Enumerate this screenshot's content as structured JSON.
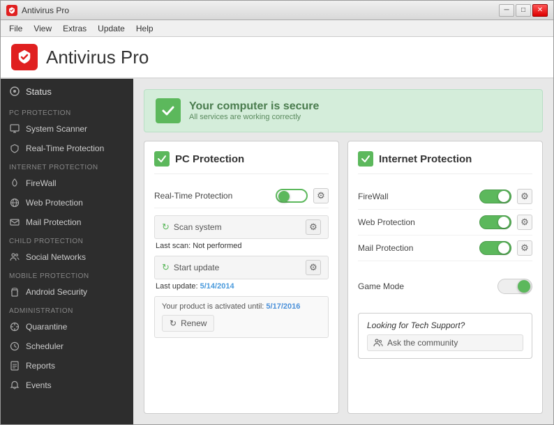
{
  "window": {
    "title": "Antivirus Pro",
    "minimize_label": "─",
    "maximize_label": "□",
    "close_label": "✕"
  },
  "menu": {
    "items": [
      "File",
      "View",
      "Extras",
      "Update",
      "Help"
    ]
  },
  "header": {
    "title": "Antivirus Pro"
  },
  "sidebar": {
    "status_label": "Status",
    "pc_protection_label": "PC PROTECTION",
    "pc_items": [
      {
        "label": "System Scanner",
        "icon": "monitor"
      },
      {
        "label": "Real-Time Protection",
        "icon": "shield"
      }
    ],
    "internet_protection_label": "INTERNET PROTECTION",
    "internet_items": [
      {
        "label": "FireWall",
        "icon": "fire"
      },
      {
        "label": "Web Protection",
        "icon": "globe"
      },
      {
        "label": "Mail Protection",
        "icon": "mail"
      }
    ],
    "child_protection_label": "CHILD PROTECTION",
    "child_items": [
      {
        "label": "Social Networks",
        "icon": "people"
      }
    ],
    "mobile_protection_label": "MOBILE PROTECTION",
    "mobile_items": [
      {
        "label": "Android Security",
        "icon": "android"
      }
    ],
    "administration_label": "ADMINISTRATION",
    "admin_items": [
      {
        "label": "Quarantine",
        "icon": "bio"
      },
      {
        "label": "Scheduler",
        "icon": "clock"
      },
      {
        "label": "Reports",
        "icon": "report"
      },
      {
        "label": "Events",
        "icon": "bell"
      }
    ]
  },
  "status": {
    "title": "Your computer is secure",
    "subtitle": "All services are working correctly"
  },
  "pc_protection": {
    "panel_title": "PC Protection",
    "real_time_label": "Real-Time Protection",
    "scan_label": "Scan system",
    "last_scan_label": "Last scan:",
    "last_scan_value": "Not performed",
    "update_label": "Start update",
    "last_update_label": "Last update:",
    "last_update_value": "5/14/2014",
    "activation_label": "Your product is activated until:",
    "activation_date": "5/17/2016",
    "renew_label": "Renew"
  },
  "internet_protection": {
    "panel_title": "Internet Protection",
    "firewall_label": "FireWall",
    "web_label": "Web Protection",
    "mail_label": "Mail Protection",
    "game_mode_label": "Game Mode",
    "tech_support_title": "Looking for Tech Support?",
    "community_label": "Ask the community"
  }
}
